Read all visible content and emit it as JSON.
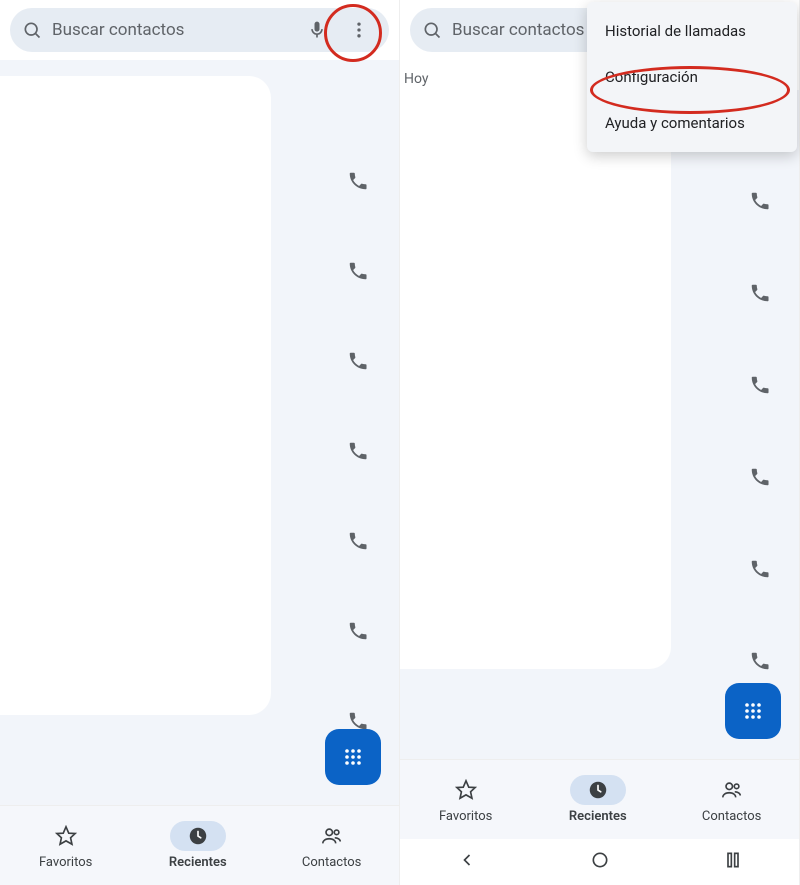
{
  "left": {
    "search_placeholder": "Buscar contactos",
    "nav": {
      "favorites": "Favoritos",
      "recents": "Recientes",
      "contacts": "Contactos"
    }
  },
  "right": {
    "search_placeholder": "Buscar contactos",
    "today_label": "Hoy",
    "menu": {
      "history": "Historial de llamadas",
      "settings": "Configuración",
      "help": "Ayuda y comentarios"
    },
    "nav": {
      "favorites": "Favoritos",
      "recents": "Recientes",
      "contacts": "Contactos"
    }
  }
}
